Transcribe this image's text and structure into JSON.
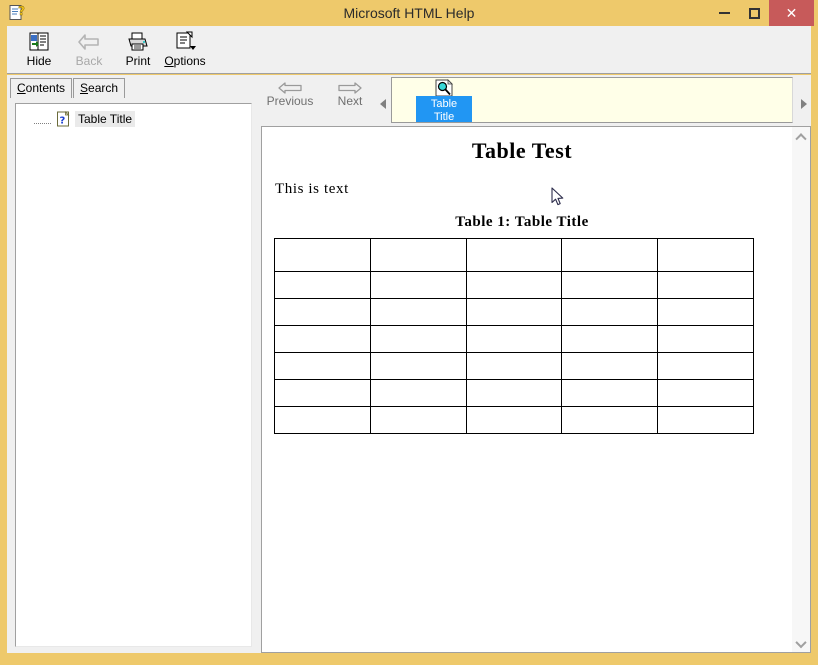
{
  "window": {
    "title": "Microsoft HTML Help",
    "app_icon": "help-document-icon",
    "frame_color": "#eec96b",
    "controls": {
      "minimize": "minimize-icon",
      "maximize": "maximize-icon",
      "close": "close-icon",
      "close_color": "#c75a5a"
    }
  },
  "toolbar": {
    "buttons": [
      {
        "label": "Hide",
        "label_pre": "",
        "accel": "",
        "label_post": "Hide",
        "icon": "hide-pane-icon",
        "disabled": false
      },
      {
        "label": "Back",
        "label_pre": "",
        "accel": "",
        "label_post": "Back",
        "icon": "back-arrow-icon",
        "disabled": true
      },
      {
        "label": "Print",
        "label_pre": "",
        "accel": "",
        "label_post": "Print",
        "icon": "printer-icon",
        "disabled": false
      },
      {
        "label": "Options",
        "label_pre": "",
        "accel": "O",
        "label_post": "ptions",
        "icon": "options-icon",
        "disabled": false
      }
    ]
  },
  "sidebar": {
    "tabs": [
      {
        "accel": "C",
        "rest": "ontents",
        "full": "Contents",
        "selected": true
      },
      {
        "accel": "S",
        "rest": "earch",
        "full": "Search",
        "selected": false
      }
    ],
    "tree": {
      "items": [
        {
          "label": "Table Title",
          "icon": "help-page-question-icon",
          "selected": true
        }
      ]
    }
  },
  "nav": {
    "previous": {
      "label": "Previous",
      "icon": "left-arrow-icon",
      "disabled": true
    },
    "next": {
      "label": "Next",
      "icon": "right-arrow-icon",
      "disabled": true
    },
    "strip_scroll_left": "scroll-left-triangle-icon",
    "strip_scroll_right": "scroll-right-triangle-icon",
    "history": {
      "background": "#ffffe8",
      "items": [
        {
          "line1": "Table",
          "line2": "Title",
          "icon": "page-magnifier-icon",
          "selected": true,
          "selected_color": "#2196f3"
        }
      ]
    }
  },
  "content": {
    "title": "Table Test",
    "paragraph": "This is text",
    "table_caption": "Table 1: Table Title",
    "table": {
      "rows": 7,
      "columns": 5,
      "cells": [
        [
          "",
          "",
          "",
          "",
          ""
        ],
        [
          "",
          "",
          "",
          "",
          ""
        ],
        [
          "",
          "",
          "",
          "",
          ""
        ],
        [
          "",
          "",
          "",
          "",
          ""
        ],
        [
          "",
          "",
          "",
          "",
          ""
        ],
        [
          "",
          "",
          "",
          "",
          ""
        ],
        [
          "",
          "",
          "",
          "",
          ""
        ]
      ]
    }
  },
  "scrollbar": {
    "up": "chevron-up-icon",
    "down": "chevron-down-icon"
  }
}
